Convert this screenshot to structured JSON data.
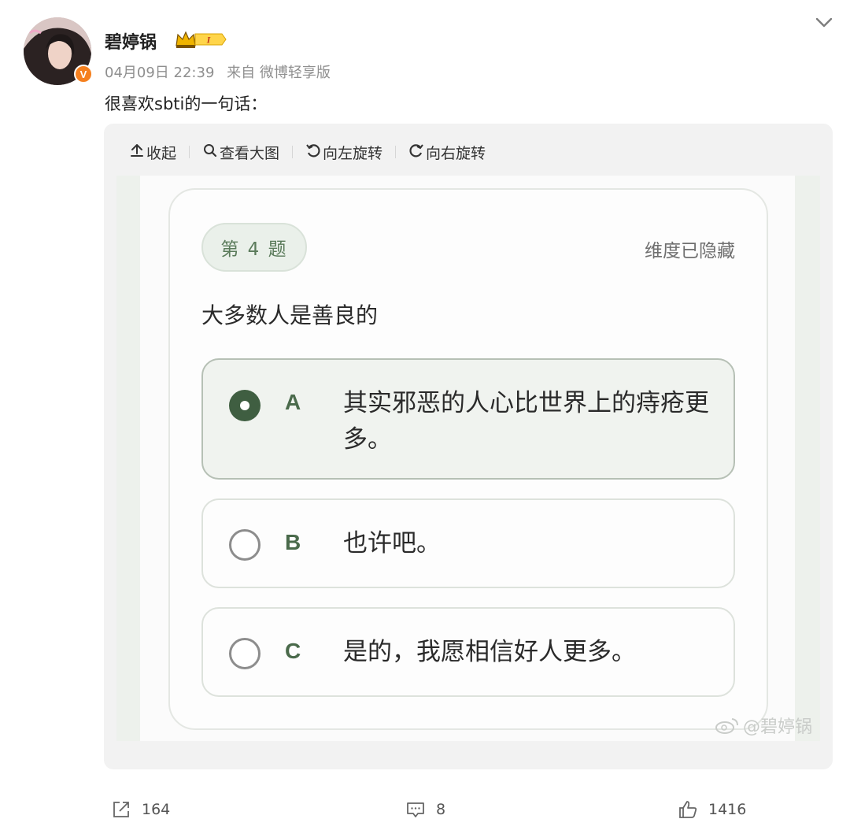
{
  "post": {
    "username": "碧婷锅",
    "member_level": "I",
    "verified_badge": "V",
    "timestamp": "04月09日 22:39",
    "source": "来自 微博轻享版",
    "text": "很喜欢sbti的一句话："
  },
  "toolbar": {
    "collapse": "收起",
    "view_large": "查看大图",
    "rotate_left": "向左旋转",
    "rotate_right": "向右旋转"
  },
  "quiz": {
    "question_number": "第 4 题",
    "dimension_label": "维度已隐藏",
    "question": "大多数人是善良的",
    "options": [
      {
        "letter": "A",
        "text": "其实邪恶的人心比世界上的痔疮更多。",
        "selected": true
      },
      {
        "letter": "B",
        "text": "也许吧。",
        "selected": false
      },
      {
        "letter": "C",
        "text": "是的，我愿相信好人更多。",
        "selected": false
      }
    ],
    "watermark": "@碧婷锅"
  },
  "actions": {
    "share_count": "164",
    "comment_count": "8",
    "like_count": "1416"
  },
  "colors": {
    "accent_green": "#3f5e41",
    "verified_orange": "#f5801f"
  }
}
